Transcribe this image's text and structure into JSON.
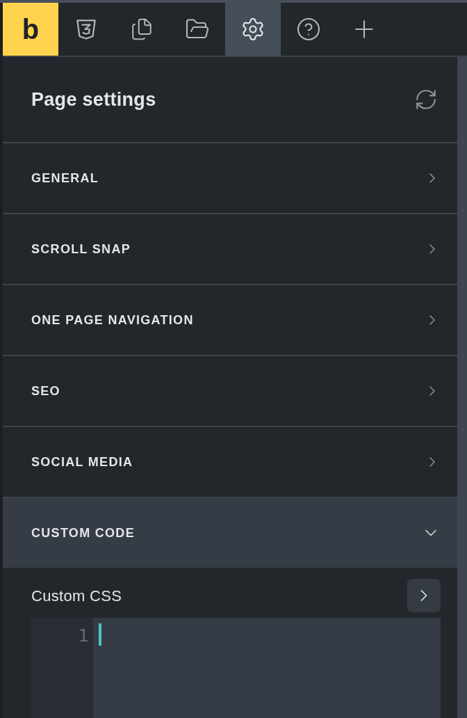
{
  "toolbar": {
    "logo": "b",
    "tabs": [
      {
        "selected": false
      },
      {
        "selected": false
      },
      {
        "selected": false
      },
      {
        "selected": true
      },
      {
        "selected": false
      },
      {
        "selected": false
      }
    ]
  },
  "panel": {
    "title": "Page settings",
    "sections": [
      {
        "label": "GENERAL",
        "expanded": false
      },
      {
        "label": "SCROLL SNAP",
        "expanded": false
      },
      {
        "label": "ONE PAGE NAVIGATION",
        "expanded": false
      },
      {
        "label": "SEO",
        "expanded": false
      },
      {
        "label": "SOCIAL MEDIA",
        "expanded": false
      },
      {
        "label": "CUSTOM CODE",
        "expanded": true,
        "body": {
          "label": "Custom CSS",
          "line_numbers": [
            "1"
          ]
        }
      }
    ]
  }
}
